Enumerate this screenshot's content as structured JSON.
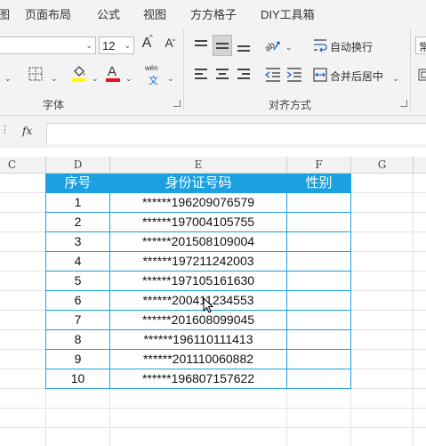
{
  "menu": {
    "partial_left": "图",
    "items": [
      "页面布局",
      "公式",
      "视图",
      "方方格子",
      "DIY工具箱"
    ]
  },
  "ribbon": {
    "font_group_label": "字体",
    "font_size": "12",
    "grow_font_label": "A",
    "shrink_font_label": "A",
    "font_color_label": "A",
    "phonetic_top": "wén",
    "phonetic_bottom": "文",
    "align_group_label": "对齐方式",
    "wrap_text_label": "自动换行",
    "merge_center_label": "合并后居中",
    "partial_right_label": "常",
    "colors": {
      "highlight": "#ffff00",
      "font_color": "#e81123"
    }
  },
  "formula_bar": {
    "fx_label": "fx",
    "value": ""
  },
  "columns": [
    "C",
    "D",
    "E",
    "F",
    "G"
  ],
  "table": {
    "headers": [
      "序号",
      "身份证号码",
      "性别"
    ],
    "rows": [
      {
        "no": "1",
        "id": "******196209076579",
        "gender": ""
      },
      {
        "no": "2",
        "id": "******197004105755",
        "gender": ""
      },
      {
        "no": "3",
        "id": "******201508109004",
        "gender": ""
      },
      {
        "no": "4",
        "id": "******197211242003",
        "gender": ""
      },
      {
        "no": "5",
        "id": "******197105161630",
        "gender": ""
      },
      {
        "no": "6",
        "id": "******200411234553",
        "gender": ""
      },
      {
        "no": "7",
        "id": "******201608099045",
        "gender": ""
      },
      {
        "no": "8",
        "id": "******196110111413",
        "gender": ""
      },
      {
        "no": "9",
        "id": "******201110060882",
        "gender": ""
      },
      {
        "no": "10",
        "id": "******196807157622",
        "gender": ""
      }
    ],
    "header_color": "#1ba1e2"
  }
}
